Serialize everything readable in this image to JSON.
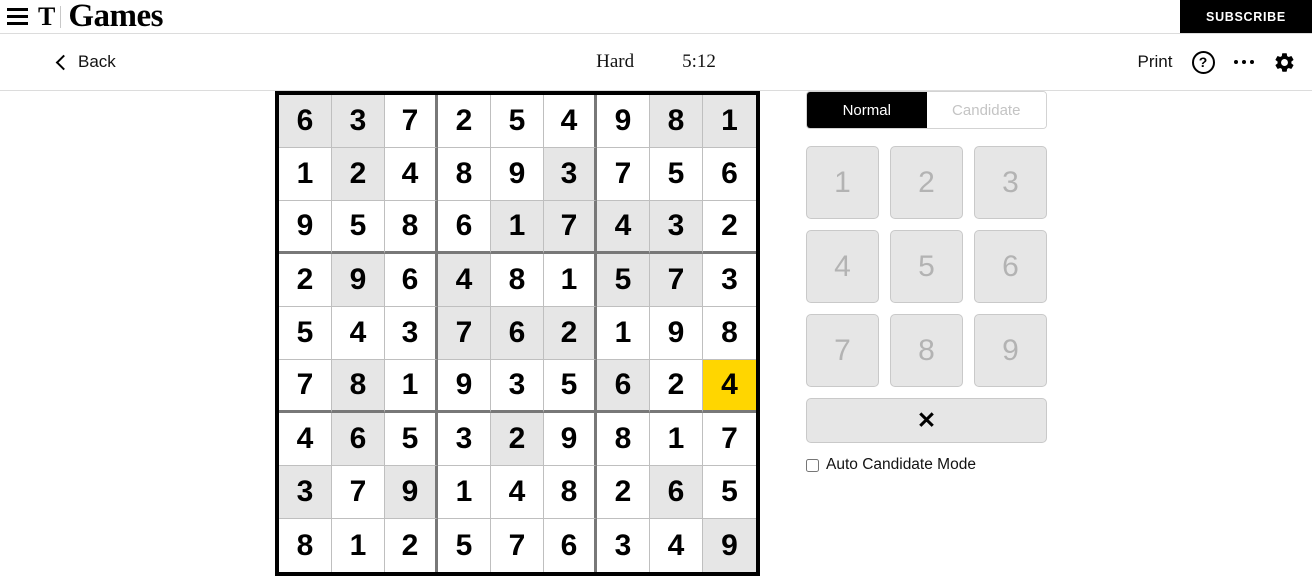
{
  "masthead": {
    "menu_icon": "hamburger-menu-icon",
    "logo_mark": "T",
    "logo_text": "Games",
    "subscribe_label": "SUBSCRIBE"
  },
  "toolbar": {
    "back_label": "Back",
    "back_icon": "chevron-left-icon",
    "difficulty": "Hard",
    "timer": "5:12",
    "print_label": "Print",
    "help_icon": "question-mark-icon",
    "help_glyph": "?",
    "more_icon": "ellipsis-icon",
    "settings_icon": "gear-icon"
  },
  "panel": {
    "modes": [
      {
        "label": "Normal",
        "active": true
      },
      {
        "label": "Candidate",
        "active": false
      }
    ],
    "numbers": [
      "1",
      "2",
      "3",
      "4",
      "5",
      "6",
      "7",
      "8",
      "9"
    ],
    "erase_label": "✕",
    "erase_icon": "erase-x-icon",
    "auto_candidate_label": "Auto Candidate Mode",
    "auto_candidate_checked": false
  },
  "colors": {
    "accent_selected": "#ffd600",
    "shaded_cell": "#e6e6e6",
    "grid_line": "#bfbfbf",
    "grid_block_line": "#787878",
    "grid_border": "#000000",
    "brand_black": "#000000"
  },
  "board": {
    "selected_cell": {
      "row": 6,
      "col": 9,
      "value": "4"
    },
    "rows": [
      {
        "values": [
          "6",
          "3",
          "7",
          "2",
          "5",
          "4",
          "9",
          "8",
          "1"
        ],
        "shaded": [
          1,
          2,
          8,
          9
        ]
      },
      {
        "values": [
          "1",
          "2",
          "4",
          "8",
          "9",
          "3",
          "7",
          "5",
          "6"
        ],
        "shaded": [
          2,
          6
        ]
      },
      {
        "values": [
          "9",
          "5",
          "8",
          "6",
          "1",
          "7",
          "4",
          "3",
          "2"
        ],
        "shaded": [
          5,
          6,
          7,
          8
        ]
      },
      {
        "values": [
          "2",
          "9",
          "6",
          "4",
          "8",
          "1",
          "5",
          "7",
          "3"
        ],
        "shaded": [
          2,
          4,
          7,
          8
        ]
      },
      {
        "values": [
          "5",
          "4",
          "3",
          "7",
          "6",
          "2",
          "1",
          "9",
          "8"
        ],
        "shaded": [
          4,
          5,
          6
        ]
      },
      {
        "values": [
          "7",
          "8",
          "1",
          "9",
          "3",
          "5",
          "6",
          "2",
          "4"
        ],
        "shaded": [
          2,
          7
        ]
      },
      {
        "values": [
          "4",
          "6",
          "5",
          "3",
          "2",
          "9",
          "8",
          "1",
          "7"
        ],
        "shaded": [
          2,
          5
        ]
      },
      {
        "values": [
          "3",
          "7",
          "9",
          "1",
          "4",
          "8",
          "2",
          "6",
          "5"
        ],
        "shaded": [
          1,
          3,
          8
        ]
      },
      {
        "values": [
          "8",
          "1",
          "2",
          "5",
          "7",
          "6",
          "3",
          "4",
          "9"
        ],
        "shaded": [
          9
        ]
      }
    ]
  }
}
